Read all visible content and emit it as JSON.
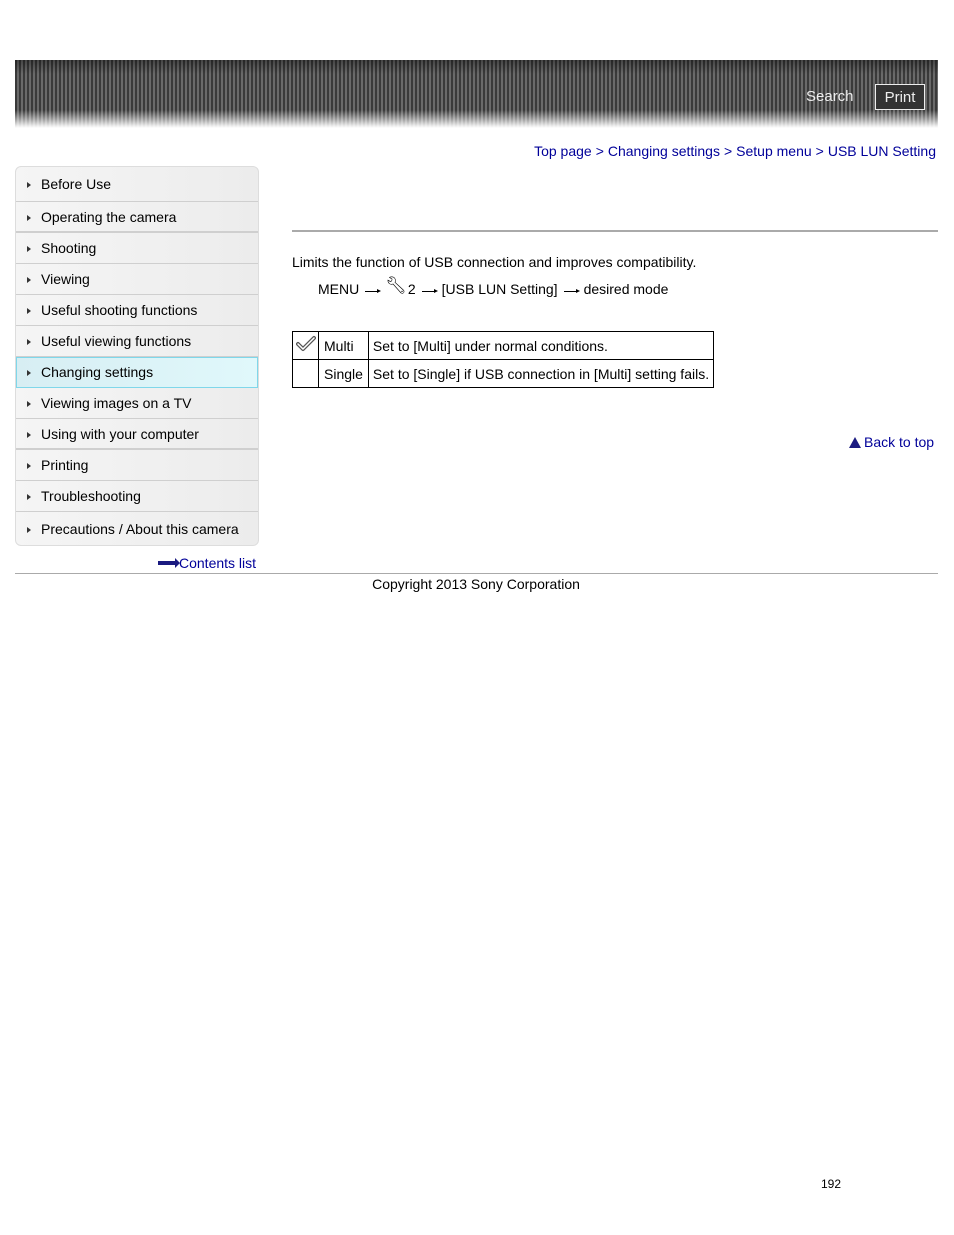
{
  "header": {
    "search_label": "Search",
    "print_label": "Print"
  },
  "breadcrumb": [
    {
      "label": "Top page"
    },
    {
      "label": "Changing settings"
    },
    {
      "label": "Setup menu"
    },
    {
      "label": "USB LUN Setting"
    }
  ],
  "breadcrumb_separator": ">",
  "sidebar": {
    "items": [
      {
        "label": "Before Use"
      },
      {
        "label": "Operating the camera"
      },
      {
        "label": "Shooting"
      },
      {
        "label": "Viewing"
      },
      {
        "label": "Useful shooting functions"
      },
      {
        "label": "Useful viewing functions"
      },
      {
        "label": "Changing settings",
        "active": true
      },
      {
        "label": "Viewing images on a TV"
      },
      {
        "label": "Using with your computer"
      },
      {
        "label": "Printing"
      },
      {
        "label": "Troubleshooting"
      },
      {
        "label": "Precautions / About this camera"
      }
    ],
    "contents_list_label": "Contents list"
  },
  "main": {
    "description": "Limits the function of USB connection and improves compatibility.",
    "menu_path": {
      "menu": "MENU",
      "setup_icon": "wrench-icon",
      "setup_page": "2",
      "item": "[USB LUN Setting]",
      "final": "desired mode"
    },
    "options": [
      {
        "default_icon": "checkmark-icon",
        "name": "Multi",
        "description": "Set to [Multi] under normal conditions."
      },
      {
        "default_icon": "",
        "name": "Single",
        "description": "Set to [Single] if USB connection in [Multi] setting fails."
      }
    ],
    "back_to_top_label": "Back to top"
  },
  "footer": {
    "copyright": "Copyright 2013 Sony Corporation",
    "page_number": "192"
  },
  "colors": {
    "link": "#000099",
    "active_nav_border": "#7fd7ea",
    "active_nav_bg": "#d7eef3"
  }
}
